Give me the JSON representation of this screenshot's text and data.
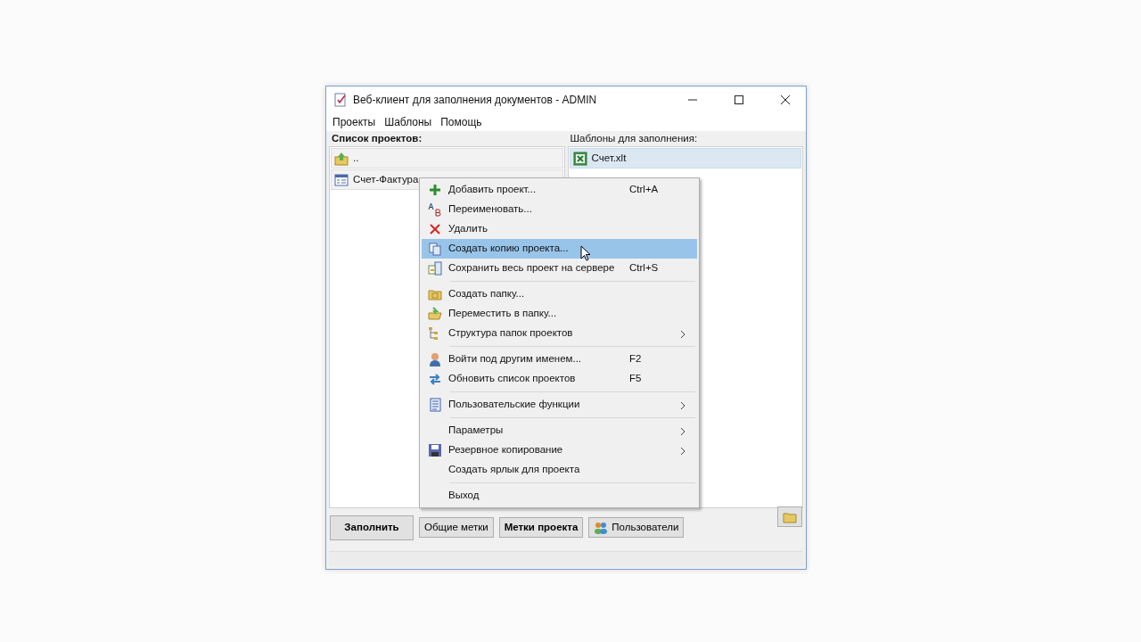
{
  "window": {
    "title": "Веб-клиент для заполнения документов - ADMIN"
  },
  "menubar": [
    "Проекты",
    "Шаблоны",
    "Помощь"
  ],
  "projects": {
    "header": "Список проектов:",
    "items": [
      {
        "label": "..",
        "kind": "up"
      },
      {
        "label": "Счет-Фактура",
        "kind": "project"
      }
    ]
  },
  "templates": {
    "header": "Шаблоны для заполнения:",
    "items": [
      {
        "label": "Счет.xlt",
        "selected": true
      }
    ]
  },
  "context_menu": [
    {
      "kind": "item",
      "label": "Добавить проект...",
      "shortcut": "Ctrl+A",
      "submenu": false,
      "selected": false
    },
    {
      "kind": "item",
      "label": "Переименовать...",
      "submenu": false,
      "selected": false
    },
    {
      "kind": "item",
      "label": "Удалить",
      "submenu": false,
      "selected": false
    },
    {
      "kind": "item",
      "label": "Создать копию проекта...",
      "submenu": false,
      "selected": true
    },
    {
      "kind": "item",
      "label": "Сохранить весь проект на сервере",
      "shortcut": "Ctrl+S",
      "submenu": false,
      "selected": false
    },
    {
      "kind": "separator"
    },
    {
      "kind": "item",
      "label": "Создать папку...",
      "submenu": false,
      "selected": false
    },
    {
      "kind": "item",
      "label": "Переместить в папку...",
      "submenu": false,
      "selected": false
    },
    {
      "kind": "item",
      "label": "Структура папок проектов",
      "submenu": true,
      "selected": false
    },
    {
      "kind": "separator"
    },
    {
      "kind": "item",
      "label": "Войти под другим именем...",
      "shortcut": "F2",
      "submenu": false,
      "selected": false
    },
    {
      "kind": "item",
      "label": "Обновить список проектов",
      "shortcut": "F5",
      "submenu": false,
      "selected": false
    },
    {
      "kind": "separator"
    },
    {
      "kind": "item",
      "label": "Пользовательские функции",
      "submenu": true,
      "selected": false
    },
    {
      "kind": "separator"
    },
    {
      "kind": "item",
      "label": "Параметры",
      "submenu": true,
      "selected": false
    },
    {
      "kind": "item",
      "label": "Резервное копирование",
      "submenu": true,
      "selected": false
    },
    {
      "kind": "item",
      "label": "Создать ярлык для проекта",
      "submenu": false,
      "selected": false
    },
    {
      "kind": "separator"
    },
    {
      "kind": "item",
      "label": "Выход",
      "submenu": false,
      "selected": false
    }
  ],
  "buttons": [
    {
      "label": "Заполнить",
      "bold": true,
      "kind": "large"
    },
    {
      "label": "Общие метки",
      "bold": false,
      "kind": "small"
    },
    {
      "label": "Метки проекта",
      "bold": true,
      "kind": "small"
    },
    {
      "label": "Пользователи",
      "bold": false,
      "kind": "users"
    },
    {
      "kind": "folder"
    }
  ]
}
